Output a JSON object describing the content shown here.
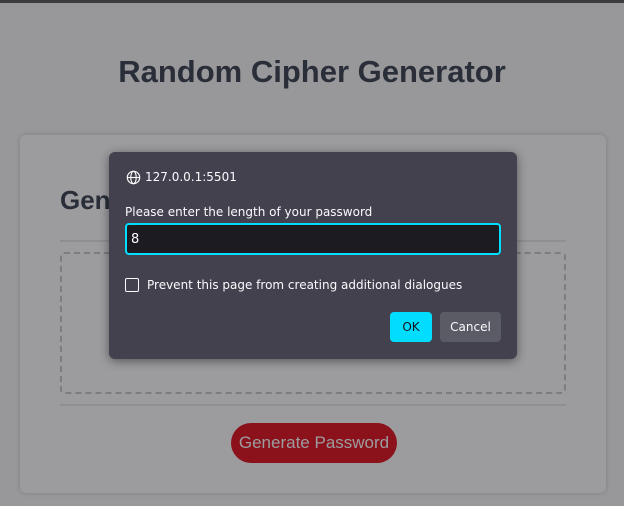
{
  "page": {
    "title": "Random Cipher Generator"
  },
  "card": {
    "header": "Generate a Password",
    "password_value": "",
    "generate_label": "Generate Password"
  },
  "dialog": {
    "origin": "127.0.0.1:5501",
    "message": "Please enter the length of your password",
    "input_value": "8",
    "prevent_label": "Prevent this page from creating additional dialogues",
    "prevent_checked": false,
    "ok_label": "OK",
    "cancel_label": "Cancel"
  },
  "icons": {
    "origin": "globe-icon"
  },
  "colors": {
    "heading": "#3b4350",
    "generate_button": "#e2101c",
    "dialog_background": "#42414d",
    "dialog_accent": "#00ddff"
  }
}
